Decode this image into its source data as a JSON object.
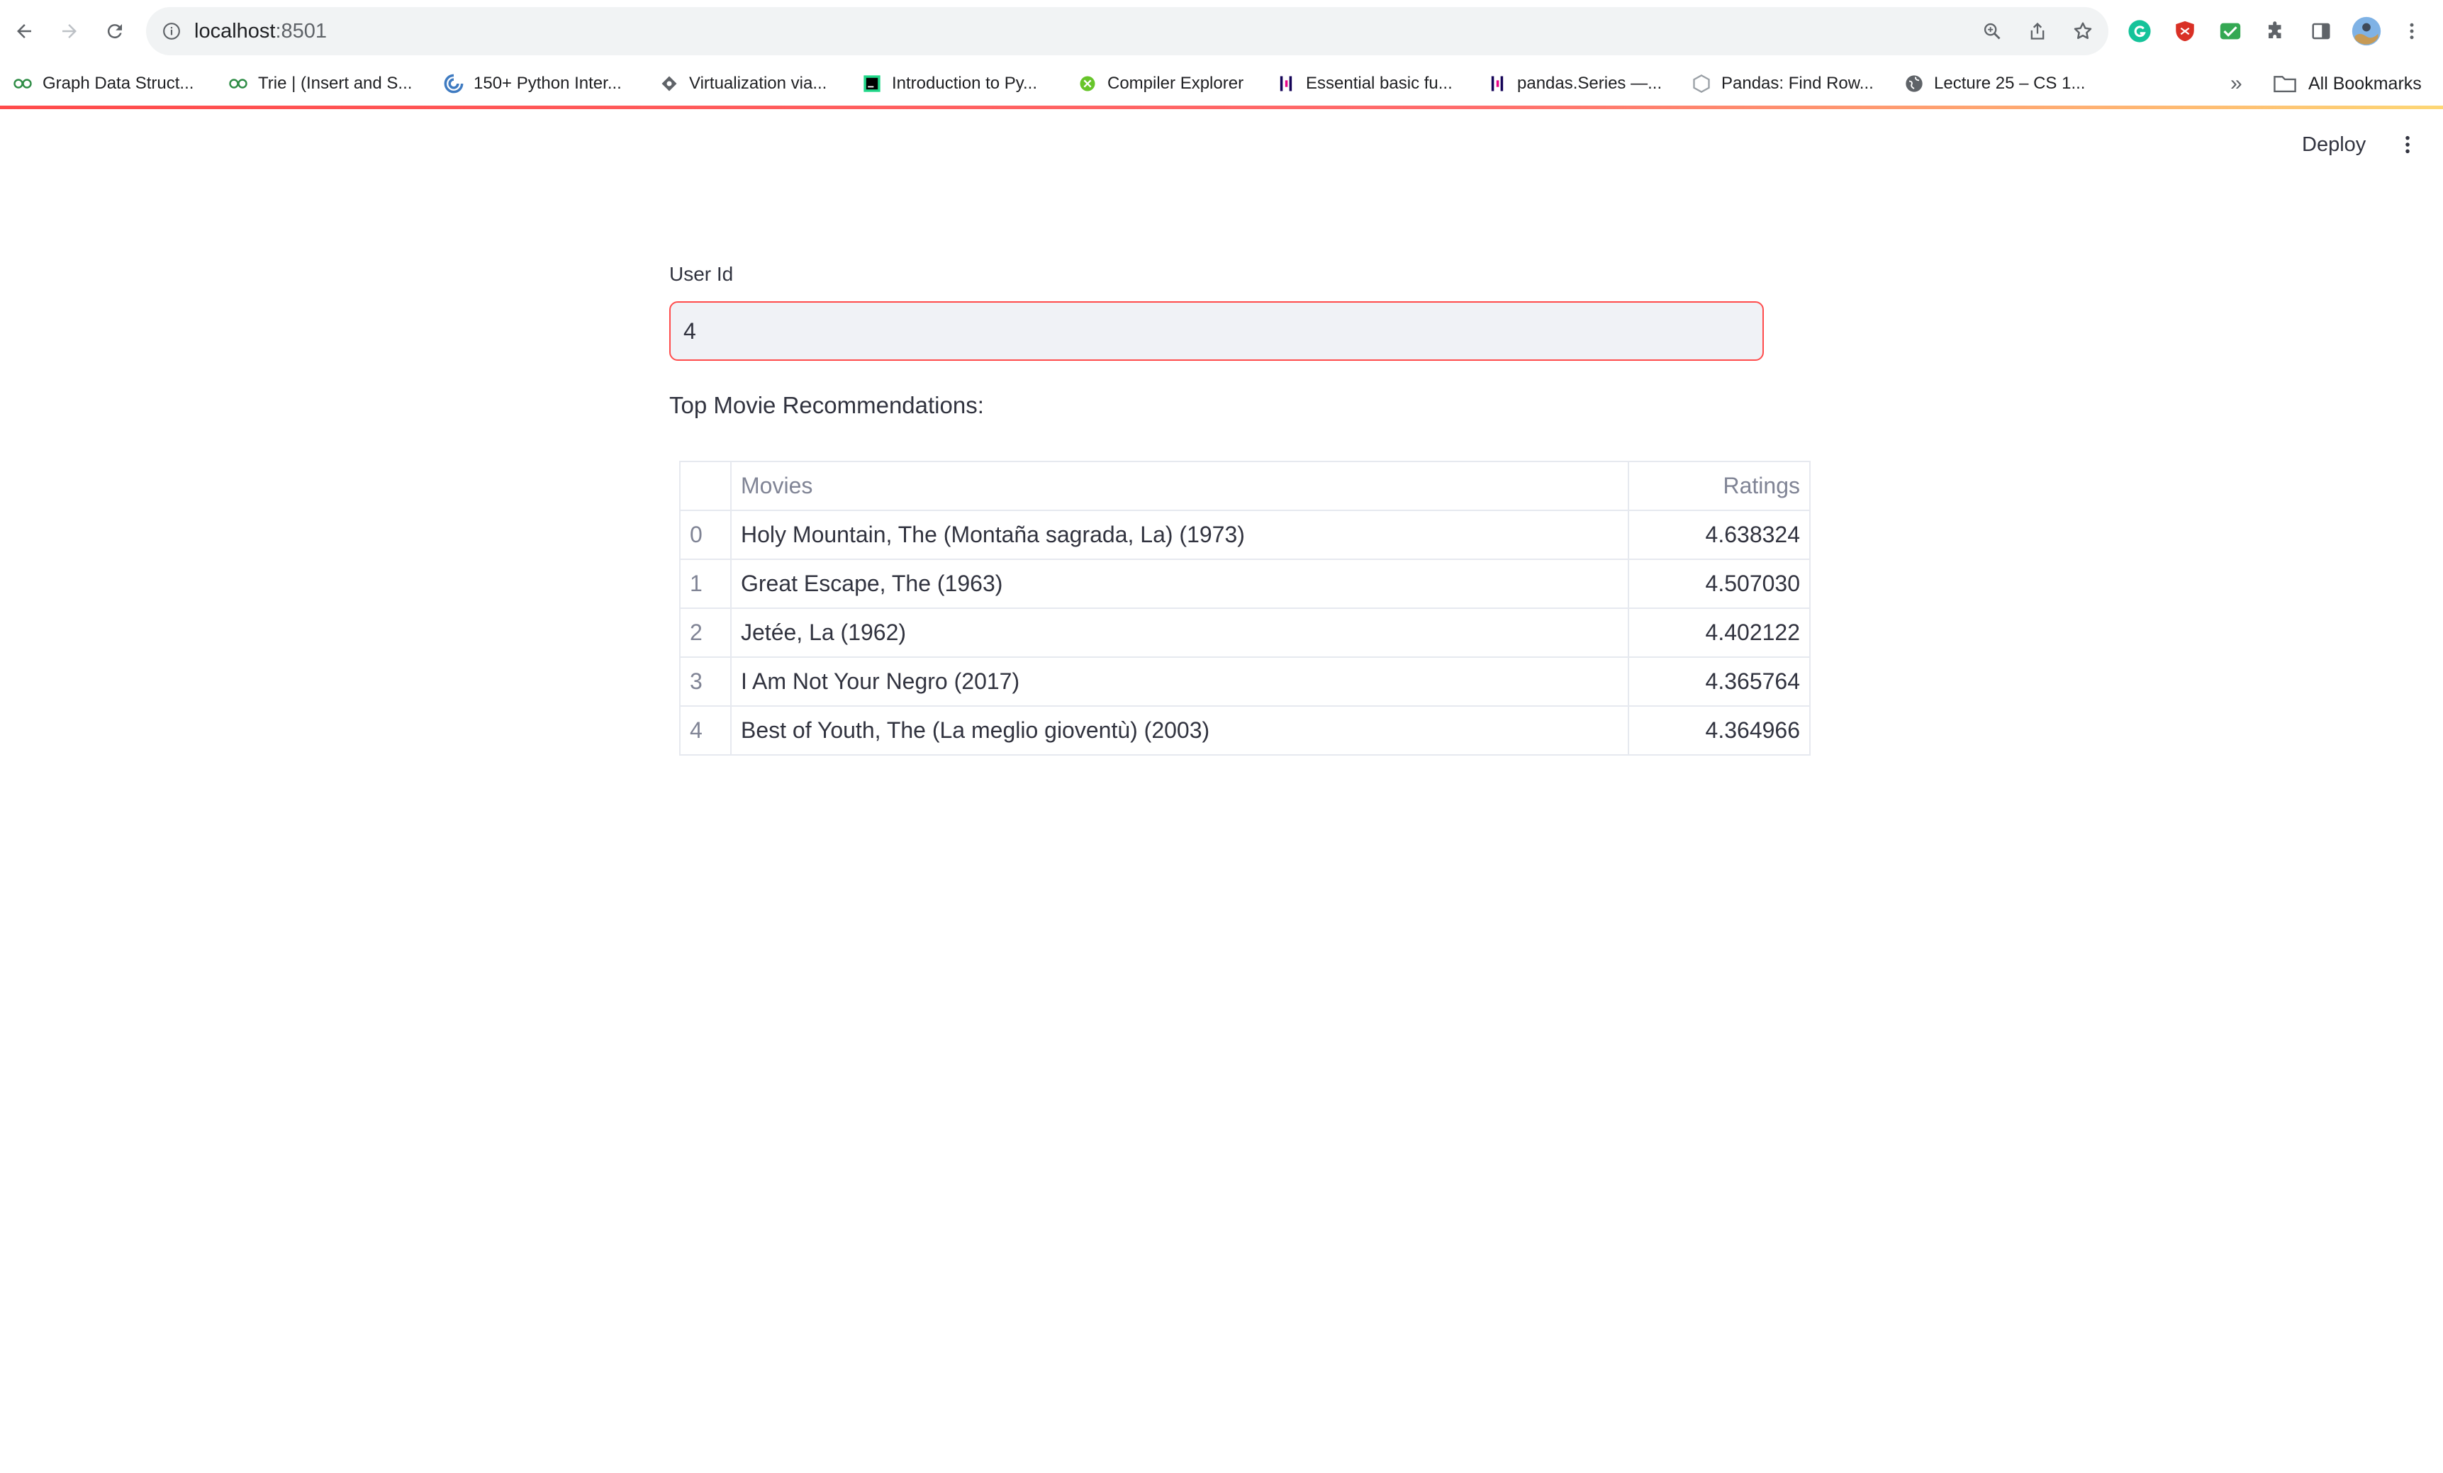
{
  "browser": {
    "url_host": "localhost",
    "url_port": ":8501",
    "bookmarks": [
      {
        "label": "Graph Data Struct...",
        "icon": "geeksforgeeks-icon"
      },
      {
        "label": "Trie | (Insert and S...",
        "icon": "geeksforgeeks-icon"
      },
      {
        "label": "150+ Python Inter...",
        "icon": "python-site-icon"
      },
      {
        "label": "Virtualization via...",
        "icon": "site-icon"
      },
      {
        "label": "Introduction to Py...",
        "icon": "pycharm-icon"
      },
      {
        "label": "Compiler Explorer",
        "icon": "compiler-explorer-icon"
      },
      {
        "label": "Essential basic fu...",
        "icon": "pandas-icon"
      },
      {
        "label": "pandas.Series —...",
        "icon": "pandas-icon"
      },
      {
        "label": "Pandas: Find Row...",
        "icon": "site-icon"
      },
      {
        "label": "Lecture 25 – CS 1...",
        "icon": "globe-icon"
      }
    ],
    "more_label": "»",
    "all_bookmarks_label": "All Bookmarks"
  },
  "header": {
    "deploy_label": "Deploy"
  },
  "form": {
    "user_id_label": "User Id",
    "user_id_value": "4"
  },
  "results": {
    "heading": "Top Movie Recommendations:",
    "columns": [
      "",
      "Movies",
      "Ratings"
    ],
    "rows": [
      {
        "index": "0",
        "movie": "Holy Mountain, The (Montaña sagrada, La) (1973)",
        "rating": "4.638324"
      },
      {
        "index": "1",
        "movie": "Great Escape, The (1963)",
        "rating": "4.507030"
      },
      {
        "index": "2",
        "movie": "Jetée, La (1962)",
        "rating": "4.402122"
      },
      {
        "index": "3",
        "movie": "I Am Not Your Negro (2017)",
        "rating": "4.365764"
      },
      {
        "index": "4",
        "movie": "Best of Youth, The (La meglio gioventù) (2003)",
        "rating": "4.364966"
      }
    ]
  },
  "colors": {
    "accent": "#ff4b4b",
    "input_bg": "#f0f2f6",
    "text": "#31333f",
    "muted": "#808495",
    "grid": "#e6e9ef"
  }
}
